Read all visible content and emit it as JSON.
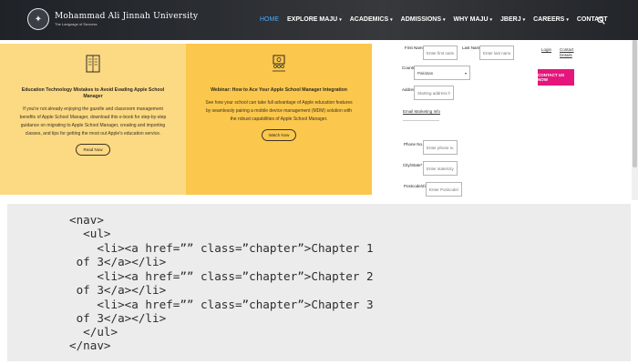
{
  "header": {
    "university_name": "Mohammad Ali Jinnah University",
    "tagline": "The Language of Success",
    "seal_glyph": "✦",
    "nav": [
      {
        "label": "HOME",
        "active": true,
        "caret": false
      },
      {
        "label": "EXPLORE MAJU",
        "active": false,
        "caret": true
      },
      {
        "label": "ACADEMICS",
        "active": false,
        "caret": true
      },
      {
        "label": "ADMISSIONS",
        "active": false,
        "caret": true
      },
      {
        "label": "WHY MAJU",
        "active": false,
        "caret": true
      },
      {
        "label": "JBERJ",
        "active": false,
        "caret": true
      },
      {
        "label": "CAREERS",
        "active": false,
        "caret": true
      },
      {
        "label": "CONTACT",
        "active": false,
        "caret": false
      }
    ],
    "search_icon": "search-icon"
  },
  "cards": [
    {
      "icon": "book-icon",
      "title": "Education Technology Mistakes to Avoid Evading Apple School Manager",
      "body": "If you're not already enjoying the gazelle and classroom management benefits of Apple School Manager, download this e-book for step-by-step guidance on migrating to Apple School Manager, creating and importing classes, and tips for getting the most out Apple's education service.",
      "button": "Read Now"
    },
    {
      "icon": "presenter-icon",
      "title": "Webinar: How to Ace Your Apple School Manager Integration",
      "body": "See how your school can take full advantage of Apple education features by seamlessly pairing a mobile device management (MDM) solution with the robust capabilities of Apple School Manager.",
      "button": "Watch Now"
    }
  ],
  "form": {
    "first_name_label": "First Name*",
    "first_name_placeholder": "Enter first name",
    "last_name_label": "Last Name*",
    "last_name_placeholder": "Enter last name",
    "country_label": "Country*",
    "country_value": "Pakistan",
    "address_label": "Address*",
    "address_placeholder": "Starting address here",
    "submit_label": "CONTACT US NOW",
    "link_1": "Login",
    "link_2": "Contact Details",
    "link_3": "Email Marketing Info",
    "phone_label": "Phone No.*",
    "phone_placeholder": "Enter phone number",
    "city_label": "City/State*",
    "city_placeholder": "Enter state/city",
    "postal_label": "Postcode/Zip*",
    "postal_placeholder": "Enter Postcode/Zip"
  },
  "code": {
    "lines": [
      "<nav>",
      "  <ul>",
      "    <li><a href=”” class=”chapter”>Chapter 1",
      " of 3</a></li>",
      "    <li><a href=”” class=”chapter”>Chapter 2",
      " of 3</a></li>",
      "    <li><a href=”” class=”chapter”>Chapter 3",
      " of 3</a></li>",
      "  </ul>",
      "</nav>"
    ]
  },
  "colors": {
    "card_light": "#fcd983",
    "card_dark": "#fbc74c",
    "nav_active": "#4aa8ff",
    "submit": "#e6157c",
    "code_bg": "#ececec"
  }
}
